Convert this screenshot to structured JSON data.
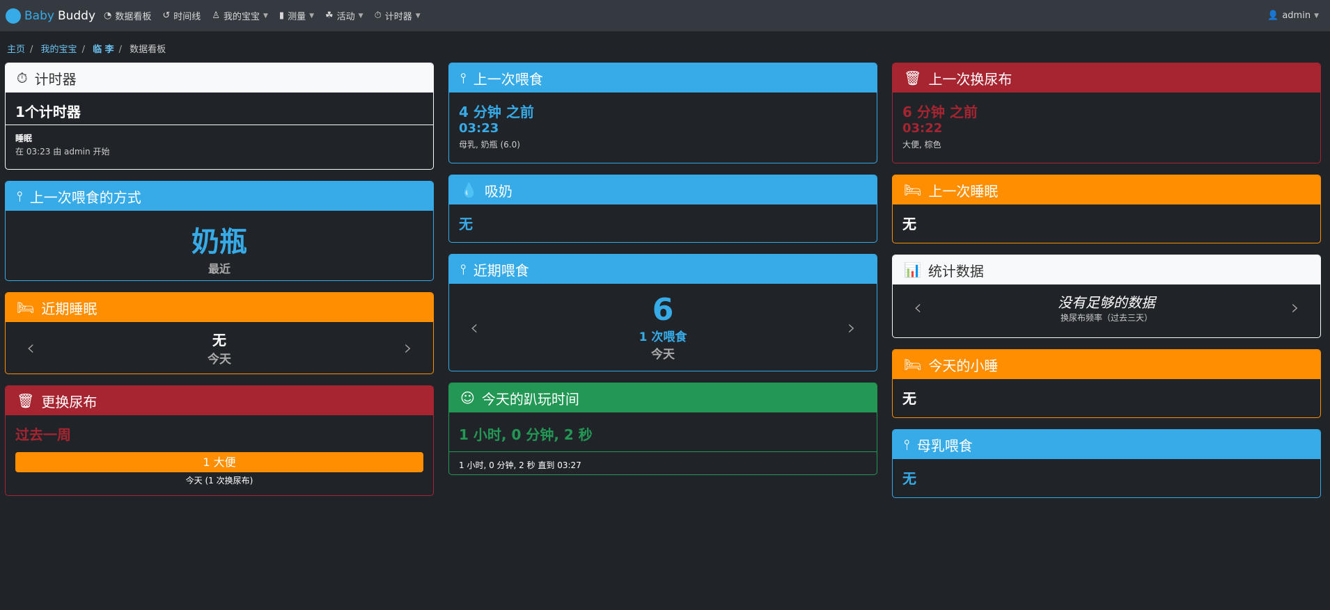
{
  "nav": {
    "brand1": "Baby",
    "brand2": "Buddy",
    "items": [
      "数据看板",
      "时间线",
      "我的宝宝",
      "测量",
      "活动",
      "计时器"
    ],
    "user": "admin"
  },
  "breadcrumb": [
    "主页",
    "我的宝宝",
    "临 李",
    "数据看板"
  ],
  "colors": {
    "primary": "#37abe8",
    "danger": "#a72431",
    "warning": "#ff8f00",
    "success": "#239855"
  },
  "cards": {
    "timer": {
      "title": "计时器",
      "count": "1个计时器",
      "name": "睡眠",
      "detail": "在 03:23 由 admin 开始"
    },
    "feed_method": {
      "title": "上一次喂食的方式",
      "value": "奶瓶",
      "sub": "最近"
    },
    "recent_sleep": {
      "title": "近期睡眠",
      "value": "无",
      "sub": "今天"
    },
    "diaper_change": {
      "title": "更换尿布",
      "period": "过去一周",
      "bar": "1 大便",
      "bar_fraction": 1.0,
      "sub": "今天 (1 次换尿布)"
    },
    "last_feeding": {
      "title": "上一次喂食",
      "ago": "4 分钟 之前",
      "time": "03:23",
      "detail": "母乳, 奶瓶 (6.0)"
    },
    "pumping": {
      "title": "吸奶",
      "value": "无"
    },
    "recent_feeding": {
      "title": "近期喂食",
      "value": "6",
      "sub1": "1 次喂食",
      "sub2": "今天"
    },
    "tummy": {
      "title": "今天的趴玩时间",
      "value": "1 小时, 0 分钟, 2 秒",
      "foot": "1 小时, 0 分钟, 2 秒 直到 03:27"
    },
    "last_diaper": {
      "title": "上一次换尿布",
      "ago": "6 分钟 之前",
      "time": "03:22",
      "detail": "大便, 棕色"
    },
    "last_sleep": {
      "title": "上一次睡眠",
      "value": "无"
    },
    "stats": {
      "title": "统计数据",
      "value": "没有足够的数据",
      "sub": "换尿布频率（过去三天）"
    },
    "naps": {
      "title": "今天的小睡",
      "value": "无"
    },
    "breastfeeding": {
      "title": "母乳喂食",
      "value": "无"
    }
  }
}
